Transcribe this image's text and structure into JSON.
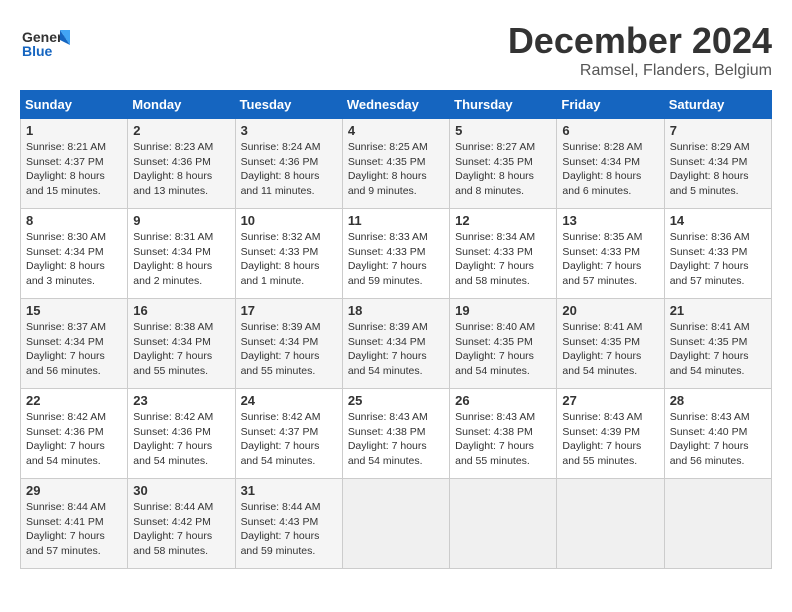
{
  "header": {
    "logo_line1": "General",
    "logo_line2": "Blue",
    "month": "December 2024",
    "location": "Ramsel, Flanders, Belgium"
  },
  "columns": [
    "Sunday",
    "Monday",
    "Tuesday",
    "Wednesday",
    "Thursday",
    "Friday",
    "Saturday"
  ],
  "weeks": [
    [
      {
        "day": "1",
        "sunrise": "Sunrise: 8:21 AM",
        "sunset": "Sunset: 4:37 PM",
        "daylight": "Daylight: 8 hours and 15 minutes."
      },
      {
        "day": "2",
        "sunrise": "Sunrise: 8:23 AM",
        "sunset": "Sunset: 4:36 PM",
        "daylight": "Daylight: 8 hours and 13 minutes."
      },
      {
        "day": "3",
        "sunrise": "Sunrise: 8:24 AM",
        "sunset": "Sunset: 4:36 PM",
        "daylight": "Daylight: 8 hours and 11 minutes."
      },
      {
        "day": "4",
        "sunrise": "Sunrise: 8:25 AM",
        "sunset": "Sunset: 4:35 PM",
        "daylight": "Daylight: 8 hours and 9 minutes."
      },
      {
        "day": "5",
        "sunrise": "Sunrise: 8:27 AM",
        "sunset": "Sunset: 4:35 PM",
        "daylight": "Daylight: 8 hours and 8 minutes."
      },
      {
        "day": "6",
        "sunrise": "Sunrise: 8:28 AM",
        "sunset": "Sunset: 4:34 PM",
        "daylight": "Daylight: 8 hours and 6 minutes."
      },
      {
        "day": "7",
        "sunrise": "Sunrise: 8:29 AM",
        "sunset": "Sunset: 4:34 PM",
        "daylight": "Daylight: 8 hours and 5 minutes."
      }
    ],
    [
      {
        "day": "8",
        "sunrise": "Sunrise: 8:30 AM",
        "sunset": "Sunset: 4:34 PM",
        "daylight": "Daylight: 8 hours and 3 minutes."
      },
      {
        "day": "9",
        "sunrise": "Sunrise: 8:31 AM",
        "sunset": "Sunset: 4:34 PM",
        "daylight": "Daylight: 8 hours and 2 minutes."
      },
      {
        "day": "10",
        "sunrise": "Sunrise: 8:32 AM",
        "sunset": "Sunset: 4:33 PM",
        "daylight": "Daylight: 8 hours and 1 minute."
      },
      {
        "day": "11",
        "sunrise": "Sunrise: 8:33 AM",
        "sunset": "Sunset: 4:33 PM",
        "daylight": "Daylight: 7 hours and 59 minutes."
      },
      {
        "day": "12",
        "sunrise": "Sunrise: 8:34 AM",
        "sunset": "Sunset: 4:33 PM",
        "daylight": "Daylight: 7 hours and 58 minutes."
      },
      {
        "day": "13",
        "sunrise": "Sunrise: 8:35 AM",
        "sunset": "Sunset: 4:33 PM",
        "daylight": "Daylight: 7 hours and 57 minutes."
      },
      {
        "day": "14",
        "sunrise": "Sunrise: 8:36 AM",
        "sunset": "Sunset: 4:33 PM",
        "daylight": "Daylight: 7 hours and 57 minutes."
      }
    ],
    [
      {
        "day": "15",
        "sunrise": "Sunrise: 8:37 AM",
        "sunset": "Sunset: 4:34 PM",
        "daylight": "Daylight: 7 hours and 56 minutes."
      },
      {
        "day": "16",
        "sunrise": "Sunrise: 8:38 AM",
        "sunset": "Sunset: 4:34 PM",
        "daylight": "Daylight: 7 hours and 55 minutes."
      },
      {
        "day": "17",
        "sunrise": "Sunrise: 8:39 AM",
        "sunset": "Sunset: 4:34 PM",
        "daylight": "Daylight: 7 hours and 55 minutes."
      },
      {
        "day": "18",
        "sunrise": "Sunrise: 8:39 AM",
        "sunset": "Sunset: 4:34 PM",
        "daylight": "Daylight: 7 hours and 54 minutes."
      },
      {
        "day": "19",
        "sunrise": "Sunrise: 8:40 AM",
        "sunset": "Sunset: 4:35 PM",
        "daylight": "Daylight: 7 hours and 54 minutes."
      },
      {
        "day": "20",
        "sunrise": "Sunrise: 8:41 AM",
        "sunset": "Sunset: 4:35 PM",
        "daylight": "Daylight: 7 hours and 54 minutes."
      },
      {
        "day": "21",
        "sunrise": "Sunrise: 8:41 AM",
        "sunset": "Sunset: 4:35 PM",
        "daylight": "Daylight: 7 hours and 54 minutes."
      }
    ],
    [
      {
        "day": "22",
        "sunrise": "Sunrise: 8:42 AM",
        "sunset": "Sunset: 4:36 PM",
        "daylight": "Daylight: 7 hours and 54 minutes."
      },
      {
        "day": "23",
        "sunrise": "Sunrise: 8:42 AM",
        "sunset": "Sunset: 4:36 PM",
        "daylight": "Daylight: 7 hours and 54 minutes."
      },
      {
        "day": "24",
        "sunrise": "Sunrise: 8:42 AM",
        "sunset": "Sunset: 4:37 PM",
        "daylight": "Daylight: 7 hours and 54 minutes."
      },
      {
        "day": "25",
        "sunrise": "Sunrise: 8:43 AM",
        "sunset": "Sunset: 4:38 PM",
        "daylight": "Daylight: 7 hours and 54 minutes."
      },
      {
        "day": "26",
        "sunrise": "Sunrise: 8:43 AM",
        "sunset": "Sunset: 4:38 PM",
        "daylight": "Daylight: 7 hours and 55 minutes."
      },
      {
        "day": "27",
        "sunrise": "Sunrise: 8:43 AM",
        "sunset": "Sunset: 4:39 PM",
        "daylight": "Daylight: 7 hours and 55 minutes."
      },
      {
        "day": "28",
        "sunrise": "Sunrise: 8:43 AM",
        "sunset": "Sunset: 4:40 PM",
        "daylight": "Daylight: 7 hours and 56 minutes."
      }
    ],
    [
      {
        "day": "29",
        "sunrise": "Sunrise: 8:44 AM",
        "sunset": "Sunset: 4:41 PM",
        "daylight": "Daylight: 7 hours and 57 minutes."
      },
      {
        "day": "30",
        "sunrise": "Sunrise: 8:44 AM",
        "sunset": "Sunset: 4:42 PM",
        "daylight": "Daylight: 7 hours and 58 minutes."
      },
      {
        "day": "31",
        "sunrise": "Sunrise: 8:44 AM",
        "sunset": "Sunset: 4:43 PM",
        "daylight": "Daylight: 7 hours and 59 minutes."
      },
      null,
      null,
      null,
      null
    ]
  ]
}
